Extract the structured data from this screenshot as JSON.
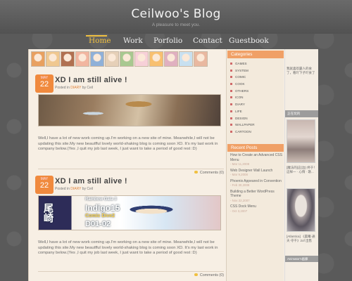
{
  "header": {
    "title": "Ceilwoo's Blog",
    "subtitle": "A pleasure to meet you."
  },
  "nav": {
    "items": [
      {
        "label": "Home",
        "active": true
      },
      {
        "label": "Work",
        "active": false
      },
      {
        "label": "Porfolio",
        "active": false
      },
      {
        "label": "Contact",
        "active": false
      },
      {
        "label": "Guestbook",
        "active": false
      }
    ]
  },
  "avatars": {
    "count": 12,
    "colors": [
      "#e8a060",
      "#f0c890",
      "#b07050",
      "#f2b6a0",
      "#8fb0d8",
      "#e6d0b8",
      "#a8c890",
      "#f7d0d8",
      "#f8c070",
      "#e0b0c0",
      "#c8e0f0",
      "#e9b8a0"
    ]
  },
  "posts": [
    {
      "month": "MAY",
      "day": "22",
      "title": "XD  I am still alive !",
      "posted_in_label": "Posted in",
      "category": "DIARY",
      "by_label": "by",
      "author": "Ceil",
      "body": "Well,I have a lot of new work coming up.I'm working on a new site of mine. Meanwhile,I will not be updating this site.My new beautfful lovely world-shaking blog is coming soon XD. It's my last work in company below.(Yes ,I quit my job last week, I just want to take a period of good rest :D)",
      "comments": "Comments (0)"
    },
    {
      "month": "MAY",
      "day": "22",
      "title": "XD  I am still alive !",
      "posted_in_label": "Posted in",
      "category": "DIARY",
      "by_label": "by",
      "author": "Ceil",
      "image_text": {
        "left": "尾崎",
        "topline": "Rainbow Gala 3",
        "big": "Indigo15",
        "small": "Comic Dive2",
        "code": "D01-02"
      },
      "body": "Well,I have a lot of new work coming up.I'm working on a new site of mine. Meanwhile,I will not be updating this site.My new beautfful lovely world-shaking blog is coming soon XD. It's my last work in company below.(Yes ,I quit my job last week, I just want to take a period of good rest :D)",
      "comments": "Comments (0)"
    }
  ],
  "sidebar": {
    "categories_title": "Categories",
    "categories": [
      "GAMES",
      "SYSTEM",
      "COMIC",
      "COOK",
      "OTHERS",
      "ICON",
      "DIARY",
      "LIFE",
      "DESIGN",
      "WALLPAPER",
      "CARTOON"
    ],
    "recent_title": "Recent  Posts",
    "recent": [
      {
        "title": "How to Create an Advanced CSS Menu",
        "date": "- Mar 11,2008"
      },
      {
        "title": "Web Designer Wall Launch",
        "date": "- Mar 9,2008"
      },
      {
        "title": "Phoenix Appeared in Convention",
        "date": "- Feb 30,2008"
      },
      {
        "title": "Building a Better WordPress Theme",
        "date": "- Nov 22,2007"
      },
      {
        "title": "CSS Dock Menu",
        "date": "- Oct 3,2007"
      }
    ]
  },
  "sidebar2": {
    "top_text": "我就喜欢霸人的食了，看吖下子吖食了",
    "tag1": "正在玩的",
    "caption1": "[魔法的]这(边) 终于！这样一 · 心情 · 歌...",
    "caption2": "[Atlantica] 《晨曦·通天·守千》2of 出售",
    "bottom_tag": "Animator's画廊"
  }
}
